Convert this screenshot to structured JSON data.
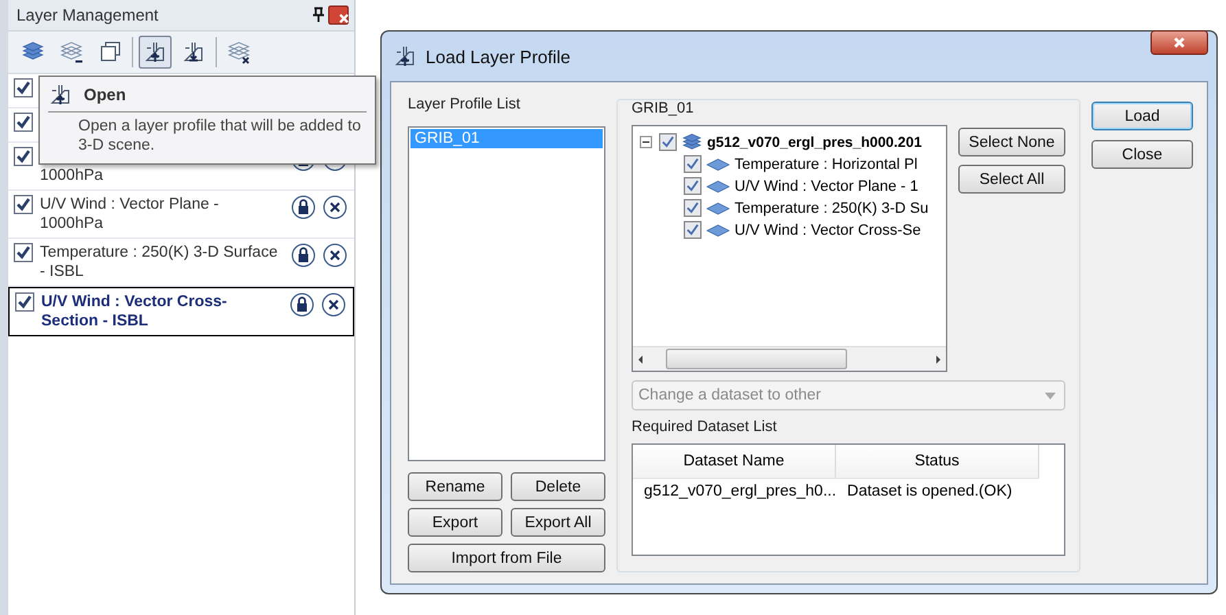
{
  "panel": {
    "title": "Layer Management",
    "toolbar": [
      {
        "kind": "stack",
        "selected": false
      },
      {
        "kind": "stack-minus",
        "selected": false
      },
      {
        "kind": "windows",
        "selected": false
      },
      {
        "kind": "open",
        "selected": true
      },
      {
        "kind": "save",
        "selected": false
      },
      {
        "kind": "stack-clear",
        "selected": false
      }
    ],
    "layers": [
      {
        "checked": true,
        "selected": false
      },
      {
        "checked": true,
        "selected": false
      },
      {
        "label": "1000hPa",
        "checked": true,
        "selected": false
      },
      {
        "label": "U/V Wind : Vector Plane - 1000hPa",
        "checked": true,
        "selected": false
      },
      {
        "label": "Temperature : 250(K) 3-D Surface - ISBL",
        "checked": true,
        "selected": false
      },
      {
        "label": "U/V Wind : Vector Cross-Section - ISBL",
        "checked": true,
        "selected": true
      }
    ],
    "tooltip": {
      "title": "Open",
      "text": "Open a layer profile that will be added to 3-D scene."
    }
  },
  "dialog": {
    "title": "Load Layer Profile",
    "profile_list": {
      "label": "Layer Profile List",
      "items": [
        {
          "label": "GRIB_01",
          "selected": true
        }
      ]
    },
    "profile_buttons": [
      "Rename",
      "Delete",
      "Export",
      "Export All",
      "Import from File"
    ],
    "group": {
      "label": "GRIB_01",
      "tree": {
        "label": "g512_v070_ergl_pres_h000.201",
        "checked": true,
        "expanded": true,
        "children": [
          {
            "label": "Temperature : Horizontal Pl",
            "checked": true
          },
          {
            "label": "U/V Wind : Vector Plane - 1",
            "checked": true
          },
          {
            "label": "Temperature : 250(K) 3-D Su",
            "checked": true
          },
          {
            "label": "U/V Wind : Vector Cross-Se",
            "checked": true
          }
        ]
      },
      "tree_buttons": [
        "Select None",
        "Select All"
      ],
      "dataset_dropdown": {
        "placeholder": "Change a dataset to other",
        "disabled": true
      },
      "required_label": "Required Dataset List",
      "table": {
        "columns": [
          "Dataset Name",
          "Status"
        ],
        "rows": [
          [
            "g512_v070_ergl_pres_h0...",
            "Dataset is opened.(OK)"
          ]
        ]
      }
    },
    "buttons": [
      {
        "label": "Load",
        "default": true
      },
      {
        "label": "Close",
        "default": false
      }
    ]
  }
}
